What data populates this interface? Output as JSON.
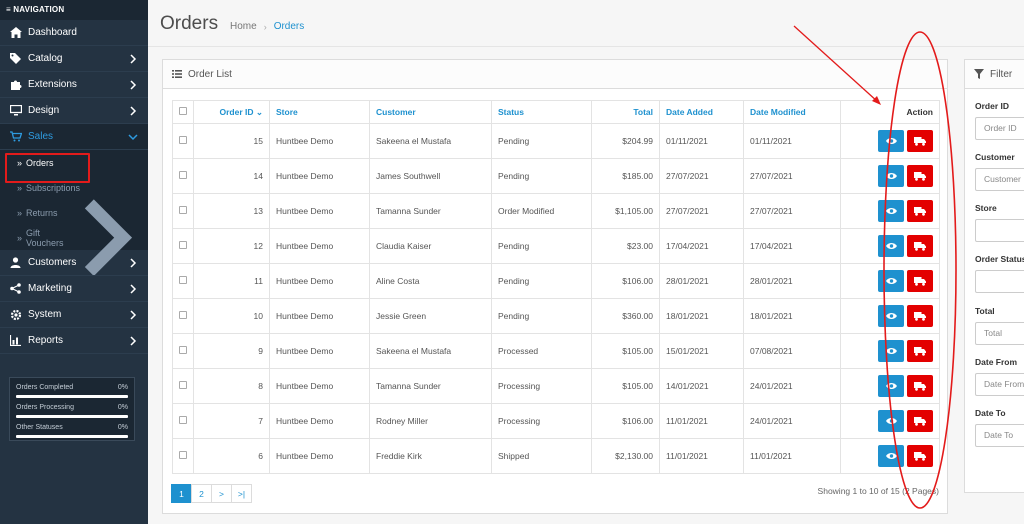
{
  "sidebar": {
    "header": "NAVIGATION",
    "items": [
      {
        "label": "Dashboard",
        "icon": "home-icon"
      },
      {
        "label": "Catalog",
        "icon": "tag-icon"
      },
      {
        "label": "Extensions",
        "icon": "puzzle-icon"
      },
      {
        "label": "Design",
        "icon": "monitor-icon"
      },
      {
        "label": "Sales",
        "icon": "cart-icon"
      },
      {
        "label": "Customers",
        "icon": "user-icon"
      },
      {
        "label": "Marketing",
        "icon": "share-icon"
      },
      {
        "label": "System",
        "icon": "gear-icon"
      },
      {
        "label": "Reports",
        "icon": "bar-chart-icon"
      }
    ],
    "sales_sub": [
      {
        "label": "Orders"
      },
      {
        "label": "Subscriptions"
      },
      {
        "label": "Returns"
      },
      {
        "label": "Gift Vouchers"
      }
    ],
    "stats": [
      {
        "label": "Orders Completed",
        "value": "0%"
      },
      {
        "label": "Orders Processing",
        "value": "0%"
      },
      {
        "label": "Other Statuses",
        "value": "0%"
      }
    ]
  },
  "header": {
    "title": "Orders",
    "breadcrumb": [
      "Home",
      "Orders"
    ]
  },
  "order_list": {
    "title": "Order List",
    "columns": [
      "Order ID",
      "Store",
      "Customer",
      "Status",
      "Total",
      "Date Added",
      "Date Modified",
      "Action"
    ],
    "rows": [
      {
        "id": "15",
        "store": "Huntbee Demo",
        "customer": "Sakeena el Mustafa",
        "status": "Pending",
        "total": "$204.99",
        "added": "01/11/2021",
        "modified": "01/11/2021"
      },
      {
        "id": "14",
        "store": "Huntbee Demo",
        "customer": "James Southwell",
        "status": "Pending",
        "total": "$185.00",
        "added": "27/07/2021",
        "modified": "27/07/2021"
      },
      {
        "id": "13",
        "store": "Huntbee Demo",
        "customer": "Tamanna Sunder",
        "status": "Order Modified",
        "total": "$1,105.00",
        "added": "27/07/2021",
        "modified": "27/07/2021"
      },
      {
        "id": "12",
        "store": "Huntbee Demo",
        "customer": "Claudia Kaiser",
        "status": "Pending",
        "total": "$23.00",
        "added": "17/04/2021",
        "modified": "17/04/2021"
      },
      {
        "id": "11",
        "store": "Huntbee Demo",
        "customer": "Aline Costa",
        "status": "Pending",
        "total": "$106.00",
        "added": "28/01/2021",
        "modified": "28/01/2021"
      },
      {
        "id": "10",
        "store": "Huntbee Demo",
        "customer": "Jessie Green",
        "status": "Pending",
        "total": "$360.00",
        "added": "18/01/2021",
        "modified": "18/01/2021"
      },
      {
        "id": "9",
        "store": "Huntbee Demo",
        "customer": "Sakeena el Mustafa",
        "status": "Processed",
        "total": "$105.00",
        "added": "15/01/2021",
        "modified": "07/08/2021"
      },
      {
        "id": "8",
        "store": "Huntbee Demo",
        "customer": "Tamanna Sunder",
        "status": "Processing",
        "total": "$105.00",
        "added": "14/01/2021",
        "modified": "24/01/2021"
      },
      {
        "id": "7",
        "store": "Huntbee Demo",
        "customer": "Rodney Miller",
        "status": "Processing",
        "total": "$106.00",
        "added": "11/01/2021",
        "modified": "24/01/2021"
      },
      {
        "id": "6",
        "store": "Huntbee Demo",
        "customer": "Freddie Kirk",
        "status": "Shipped",
        "total": "$2,130.00",
        "added": "11/01/2021",
        "modified": "11/01/2021"
      }
    ],
    "pagination": [
      "1",
      "2",
      ">",
      ">|"
    ],
    "showing": "Showing 1 to 10 of 15 (2 Pages)"
  },
  "filter": {
    "title": "Filter",
    "fields": [
      {
        "label": "Order ID",
        "placeholder": "Order ID"
      },
      {
        "label": "Customer",
        "placeholder": "Customer"
      },
      {
        "label": "Store",
        "placeholder": ""
      },
      {
        "label": "Order Status",
        "placeholder": ""
      },
      {
        "label": "Total",
        "placeholder": "Total"
      },
      {
        "label": "Date From",
        "placeholder": "Date From"
      },
      {
        "label": "Date To",
        "placeholder": "Date To"
      }
    ]
  },
  "colors": {
    "sidebar_bg": "#243342",
    "accent": "#1e91cf",
    "danger": "#e30000",
    "annotation": "#e31b1b"
  }
}
